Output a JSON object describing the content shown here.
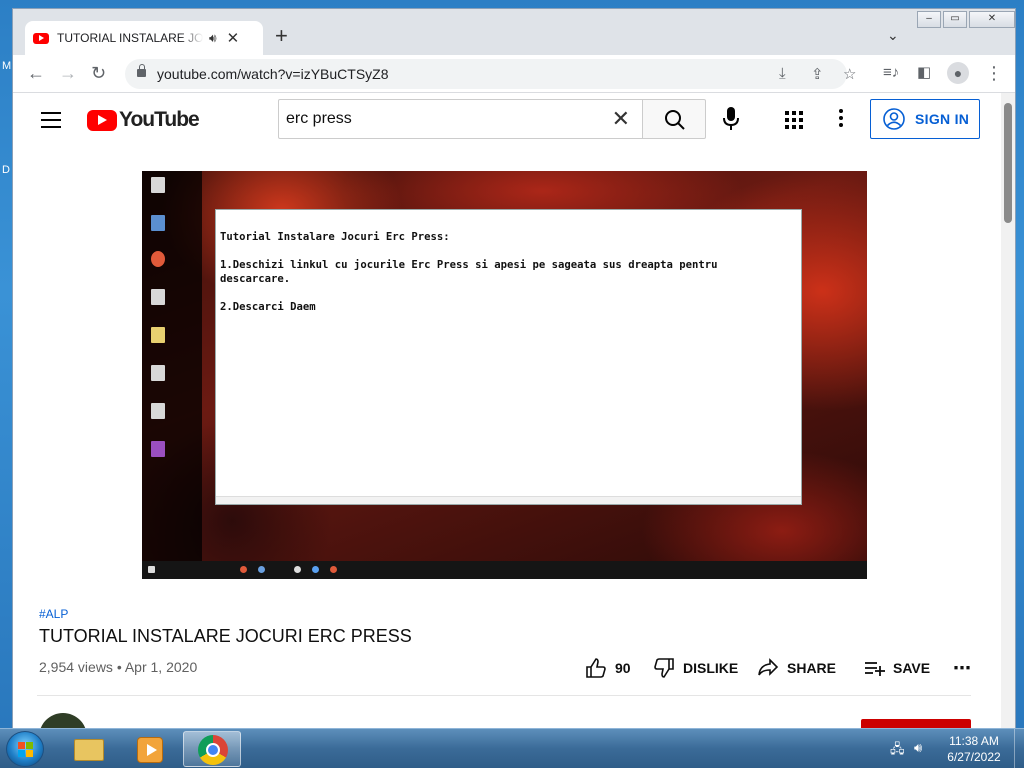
{
  "desktop": {
    "edge_letters": [
      "M",
      "D"
    ]
  },
  "browser": {
    "tab": {
      "title": "TUTORIAL INSTALARE JOCURI ERC PRESS",
      "audio_icon": "speaker-icon",
      "close": "✕"
    },
    "new_tab": "+",
    "tab_search": "⌄",
    "window_controls": {
      "minimize": "–",
      "restore": "▭",
      "close": "✕"
    },
    "toolbar": {
      "back": "←",
      "forward": "→",
      "reload": "↻",
      "url": "youtube.com/watch?v=izYBuCTSyZ8",
      "omnibox_icons": [
        "install-icon",
        "share-icon",
        "bookmark-star-icon"
      ],
      "right_icons": [
        "media-control-icon",
        "side-panel-icon",
        "profile-icon",
        "more-menu-icon"
      ]
    }
  },
  "youtube": {
    "logo_text": "YouTube",
    "search": {
      "value": "erc press",
      "clear": "✕"
    },
    "sign_in": "SIGN IN",
    "video_content": {
      "notepad_lines": [
        "Tutorial Instalare Jocuri Erc Press:",
        "",
        "1.Deschizi linkul cu jocurile Erc Press si apesi pe sageata sus dreapta pentru",
        "descarcare.",
        "",
        "2.Descarci Daem"
      ]
    },
    "hashtag": "#ALP",
    "title": "TUTORIAL INSTALARE JOCURI ERC PRESS",
    "meta": "2,954 views • Apr 1, 2020",
    "actions": {
      "like_count": "90",
      "dislike": "DISLIKE",
      "share": "SHARE",
      "save": "SAVE",
      "more": "⋯"
    }
  },
  "taskbar": {
    "apps": [
      "windows-explorer",
      "media-player",
      "google-chrome"
    ],
    "active_app": "google-chrome",
    "clock": {
      "time": "11:38 AM",
      "date": "6/27/2022"
    }
  },
  "colors": {
    "youtube_red": "#ff0000",
    "link_blue": "#065fd4",
    "taskbar_blue": "#3b6b98"
  }
}
